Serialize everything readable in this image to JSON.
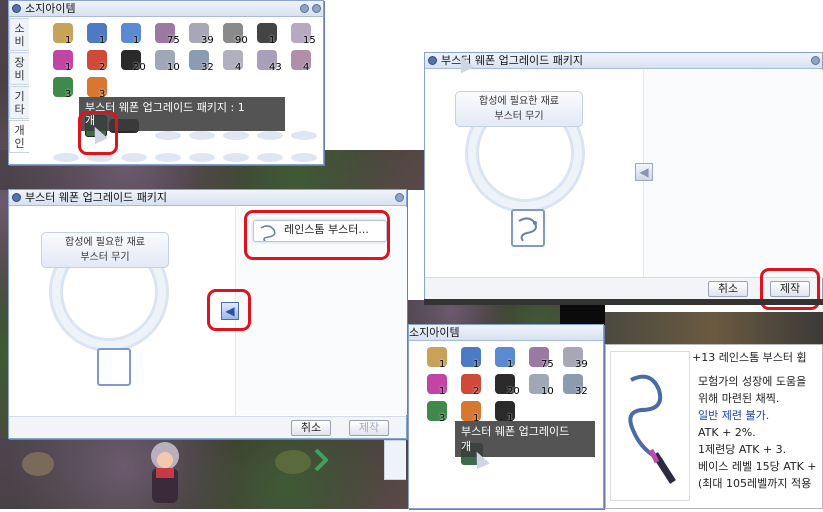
{
  "inventory_top": {
    "title": "소지아이템",
    "tabs": [
      "소비",
      "장비",
      "기타",
      "개인"
    ],
    "items": [
      {
        "icon": "bag-icon",
        "color": "#c9a25a",
        "count": "1"
      },
      {
        "icon": "gift-box-icon",
        "color": "#4e79c4",
        "count": "1"
      },
      {
        "icon": "gift-box-icon",
        "color": "#5a8ad0",
        "count": "1"
      },
      {
        "icon": "feather-icon",
        "color": "#9a7aa0",
        "count": "75"
      },
      {
        "icon": "slime-icon",
        "color": "#a7a7b8",
        "count": "39"
      },
      {
        "icon": "magnifier-icon",
        "color": "#8a8a8a",
        "count": "90"
      },
      {
        "icon": "stone-icon",
        "color": "#444444",
        "count": "1"
      },
      {
        "icon": "slime-icon",
        "color": "#b6a9c0",
        "count": "15"
      },
      {
        "icon": "pink-gem-icon",
        "color": "#c245a3",
        "count": "1"
      },
      {
        "icon": "red-box-icon",
        "color": "#d04a3a",
        "count": "2"
      },
      {
        "icon": "black-stone-icon",
        "color": "#2a2a2a",
        "count": "20"
      },
      {
        "icon": "slime-icon",
        "color": "#a0a8b8",
        "count": "10"
      },
      {
        "icon": "slime-icon",
        "color": "#8c9cb0",
        "count": "32"
      },
      {
        "icon": "slime-icon",
        "color": "#b0b0c0",
        "count": "4"
      },
      {
        "icon": "slime-icon",
        "color": "#a8a0b8",
        "count": "43"
      },
      {
        "icon": "slime-icon",
        "color": "#b090a8",
        "count": "4"
      },
      {
        "icon": "green-book-icon",
        "color": "#3f8a4a",
        "count": "3"
      },
      {
        "icon": "orange-box-icon",
        "color": "#d87830",
        "count": "3"
      }
    ],
    "tooltip": {
      "line1": "부스터 웨폰 업그레이드 패키지 : 1",
      "line2": "개"
    }
  },
  "upgrade_top": {
    "title": "부스터 웨폰 업그레이드 패키지",
    "req_line1": "합성에 필요한 재료",
    "req_line2": "부스터 무기",
    "cancel": "취소",
    "make": "제작"
  },
  "upgrade_main": {
    "title": "부스터 웨폰 업그레이드 패키지",
    "req_line1": "합성에 필요한 재료",
    "req_line2": "부스터 무기",
    "result_item": "레인스톰 부스터...",
    "cancel": "취소",
    "make": "제작"
  },
  "inventory_bottom": {
    "title": "소지아이템",
    "tab": "개인",
    "counts": [
      "1",
      "1",
      "1",
      "75",
      "39",
      "1",
      "2",
      "20",
      "10",
      "32",
      "3",
      "1",
      "1"
    ],
    "tooltip": {
      "line1": "부스터 웨폰 업그레이드",
      "line2": "개"
    }
  },
  "item_desc": {
    "title": "+13 레인스톰 부스터 휩",
    "lines": [
      "모험가의 성장에 도움을",
      "위해 마련된 채찍.",
      "일반 제련 불가.",
      "ATK + 2%.",
      "1제련당 ATK + 3.",
      "베이스 레벨 15당 ATK +",
      "(최대 105레벨까지 적용"
    ]
  }
}
